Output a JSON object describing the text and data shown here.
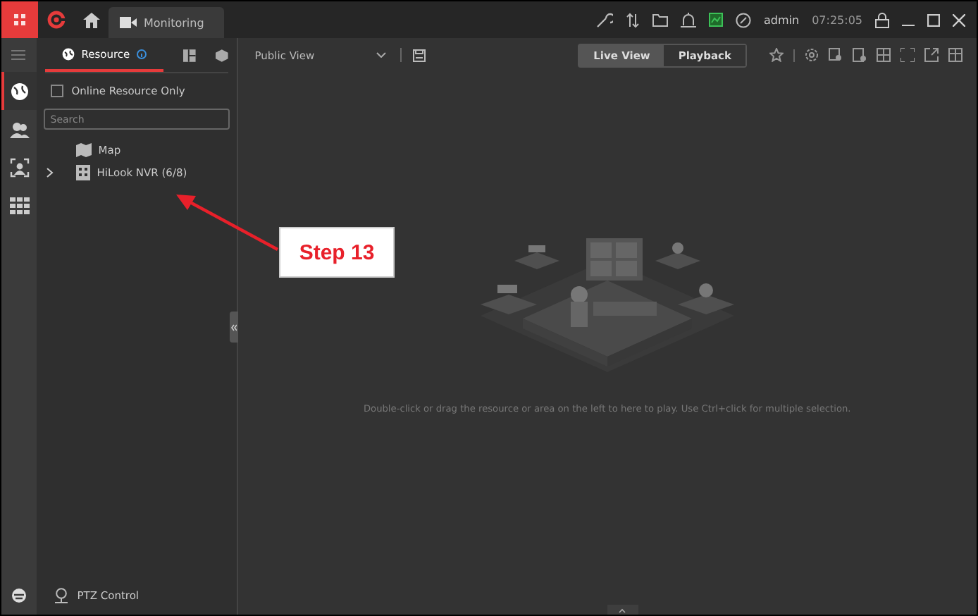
{
  "title_bar": {
    "tabs": [
      {
        "label": "Monitoring",
        "selected": true
      }
    ],
    "user": "admin",
    "time": "07:25:05"
  },
  "nav_rail": {
    "items": [
      {
        "kind": "globe",
        "selected": true
      },
      {
        "kind": "people",
        "selected": false
      },
      {
        "kind": "face-scan",
        "selected": false
      },
      {
        "kind": "grid",
        "selected": false
      }
    ]
  },
  "resource_panel": {
    "tab": {
      "label": "Resource",
      "selected": true
    },
    "online_only": {
      "label": "Online Resource Only",
      "checked": false
    },
    "search": {
      "placeholder": "Search"
    },
    "tree": [
      {
        "kind": "map",
        "label": "Map"
      },
      {
        "kind": "device",
        "label": "HiLook NVR (6/8)",
        "expanded": false
      }
    ],
    "ptz": {
      "label": "PTZ Control"
    }
  },
  "view_bar": {
    "view": "Public View",
    "modes": [
      {
        "label": "Live View",
        "selected": true
      },
      {
        "label": "Playback",
        "selected": false
      }
    ]
  },
  "hint": "Double-click or drag the resource or area on the left to here to play. Use Ctrl+click for multiple selection.",
  "annotation": {
    "label": "Step 13"
  }
}
